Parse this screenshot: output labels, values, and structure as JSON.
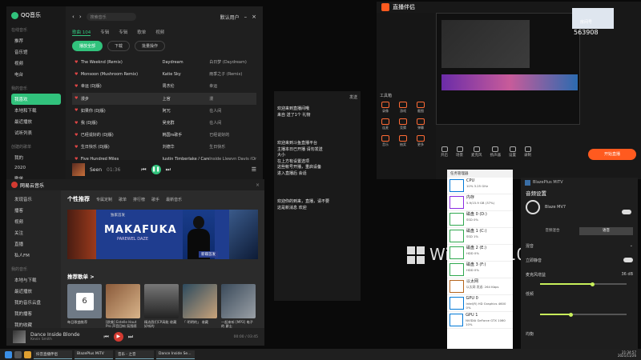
{
  "qq": {
    "app": "QQ音乐",
    "search_placeholder": "搜索音乐",
    "user": "默认用户",
    "nav": [
      {
        "group": "在线音乐",
        "items": [
          "推荐",
          "音乐馆",
          "视频",
          "电台"
        ]
      },
      {
        "group": "我的音乐",
        "items": [
          "我喜欢",
          "本地和下载",
          "最近播放",
          "试听列表"
        ]
      },
      {
        "group": "创建的歌单",
        "items": [
          "我的",
          "2020",
          "歌单"
        ]
      }
    ],
    "tabs": [
      "歌曲 104",
      "专辑",
      "专辑",
      "歌单",
      "视频"
    ],
    "buttons": {
      "play_all": "播放全部",
      "download": "下载",
      "batch": "批量操作"
    },
    "songs": [
      {
        "title": "The Weeknd (Remix)",
        "artist": "Daydream",
        "album": "白日梦 (Daydream)"
      },
      {
        "title": "Monsoon (Mushroom Remix)",
        "artist": "Katie Sky",
        "album": "雨季之子 (Remix)"
      },
      {
        "title": "幸运 (DJ版)",
        "artist": "周杰伦",
        "album": "幸运"
      },
      {
        "title": "漫步",
        "artist": "上官",
        "album": "漫"
      },
      {
        "title": "如果你 (DJ版)",
        "artist": "阿冗",
        "album": "在人间"
      },
      {
        "title": "我 (DJ版)",
        "artist": "吴克群",
        "album": "在人间"
      },
      {
        "title": "已经说好的 (DJ版)",
        "artist": "韩国rs歌手",
        "album": "已经说好的"
      },
      {
        "title": "生日快乐 (DJ版)",
        "artist": "刘德华",
        "album": "生日快乐"
      },
      {
        "title": "Five Hundred Miles",
        "artist": "Justin Timberlake / Carey",
        "album": "Inside Llewyn Davis (Original)"
      }
    ],
    "player": {
      "song": "Seen",
      "time": "01:36"
    }
  },
  "netease": {
    "app": "网易云音乐",
    "nav": [
      "发现音乐",
      "播客",
      "视频",
      "关注",
      "直播",
      "私人FM"
    ],
    "my_group": "我的音乐",
    "my_items": [
      "本地与下载",
      "最近播放",
      "我的音乐云盘",
      "我的播客",
      "我的收藏"
    ],
    "tabs": [
      "个性推荐",
      "专属定制",
      "歌单",
      "排行榜",
      "歌手",
      "最新音乐"
    ],
    "banner": {
      "title": "MAKAFUKA",
      "subtitle": "PAREWEL DAZE",
      "tag": "新碟首发",
      "small": "独家首发"
    },
    "section": "推荐歌单 >",
    "cards": [
      {
        "title": "每日歌曲推荐"
      },
      {
        "title": "[欧美] Estelle Haut Pro 声音回响 氛围感"
      },
      {
        "title": "精选我们CP高能 收藏好听的"
      },
      {
        "title": "「 明明的」 收藏"
      },
      {
        "title": "一起来听 [MP3] 电子的 爵士"
      }
    ],
    "player": {
      "song": "Dance Inside Blonde",
      "artist": "Kevin Smith",
      "time": "00:00 / 03:45"
    }
  },
  "chat": {
    "header": "发送",
    "lines": [
      "欢迎来到直播间哦",
      "来自 送了1个 礼物",
      "欢迎来到斗鱼直播平台",
      "主播本日已开播 请勿发送",
      "大小",
      "在上方有设置选项",
      "这些帐号开播，重启设备",
      "进入直播后 会话",
      "欢迎你的到来，直播，请不要",
      "这是新消息 欢迎"
    ]
  },
  "live": {
    "app": "直播伴侣",
    "tools_label": "工具箱",
    "tools": [
      "录像",
      "游戏",
      "截图",
      "连麦",
      "竞猜",
      "弹幕",
      "音乐",
      "抽奖",
      "更多"
    ],
    "bottom": [
      "开启",
      "场景",
      "麦克风",
      "扬声器",
      "设置",
      "录制"
    ],
    "start": "开始直播",
    "badge": "563908",
    "room": "房间号"
  },
  "taskmgr": {
    "title": "任务管理器",
    "items": [
      {
        "name": "CPU",
        "sub": "10%  3.25 GHz",
        "color": "#0078d7"
      },
      {
        "name": "内存",
        "sub": "5.9/15.9 GB (37%)",
        "color": "#8a2be2"
      },
      {
        "name": "磁盘 0 (D:)",
        "sub": "SSD 0%",
        "color": "#2fa84f"
      },
      {
        "name": "磁盘 1 (C:)",
        "sub": "SSD 1%",
        "color": "#2fa84f"
      },
      {
        "name": "磁盘 2 (E:)",
        "sub": "HDD 0%",
        "color": "#2fa84f"
      },
      {
        "name": "磁盘 3 (F:)",
        "sub": "HDD 0%",
        "color": "#2fa84f"
      },
      {
        "name": "以太网",
        "sub": "以太网 发送: 264 Kbps",
        "color": "#b5651d"
      },
      {
        "name": "GPU 0",
        "sub": "Intel(R) HD Graphics 4600 0%",
        "color": "#0078d7"
      },
      {
        "name": "GPU 1",
        "sub": "NVIDIA GeForce GTX 1060 10%",
        "color": "#0078d7"
      }
    ]
  },
  "desktop": {
    "wm": "Windows 10"
  },
  "gamebar": {
    "app": "BlazePlus MiTV",
    "section": "音频设置",
    "device": "Blaze MV7",
    "tabs": [
      "音频混合",
      "语音"
    ],
    "rows": [
      {
        "label": "混音",
        "value": ""
      },
      {
        "label": "立即静音",
        "value": ""
      },
      {
        "label": "麦克风增益",
        "value": "36 dB"
      },
      {
        "label": "低频",
        "value": ""
      },
      {
        "label": "均衡",
        "value": ""
      }
    ],
    "levels": {
      "gain": 0.6,
      "mix": 0.4,
      "low": 0.35
    }
  },
  "taskbar": {
    "windows": [
      "抖音直播伴侣",
      "BlazePlus MiTV",
      "音乐 - 之音",
      "Dance Inside Se..."
    ],
    "time": "21:34:57",
    "date": "2021/11/26"
  },
  "colors": {
    "qq": "#31c27c",
    "netease": "#d33a31",
    "live": "#ff5a1f",
    "gain": "#c8f05a"
  }
}
